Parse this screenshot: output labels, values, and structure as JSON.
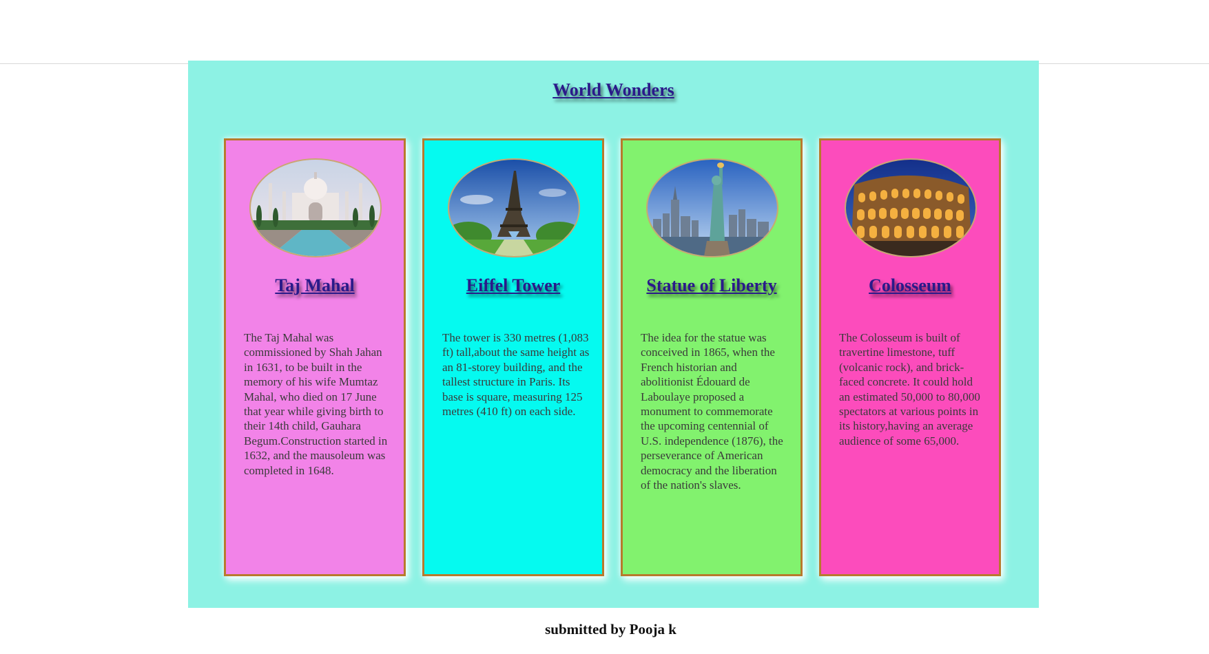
{
  "page": {
    "title": "World Wonders",
    "footer": "submitted by Pooja k"
  },
  "colors": {
    "panel": "#8df2e4",
    "title_link": "#2a1a8a",
    "card_border": "#b87a2c"
  },
  "cards": [
    {
      "title": "Taj Mahal",
      "image": "taj-mahal-photo",
      "background": "#f283e8",
      "description": "The Taj Mahal was commissioned by Shah Jahan in 1631, to be built in the memory of his wife Mumtaz Mahal, who died on 17 June that year while giving birth to their 14th child, Gauhara Begum.Construction started in 1632, and the mausoleum was completed in 1648."
    },
    {
      "title": "Eiffel Tower",
      "image": "eiffel-tower-photo",
      "background": "#05faf0",
      "description": "The tower is 330 metres (1,083 ft) tall,about the same height as an 81-storey building, and the tallest structure in Paris. Its base is square, measuring 125 metres (410 ft) on each side."
    },
    {
      "title": "Statue of Liberty",
      "image": "statue-of-liberty-photo",
      "background": "#82f26e",
      "description": "The idea for the statue was conceived in 1865, when the French historian and abolitionist Édouard de Laboulaye proposed a monument to commemorate the upcoming centennial of U.S. independence (1876), the perseverance of American democracy and the liberation of the nation's slaves."
    },
    {
      "title": "Colosseum",
      "image": "colosseum-photo",
      "background": "#fc4cbc",
      "description": "The Colosseum is built of travertine limestone, tuff (volcanic rock), and brick-faced concrete. It could hold an estimated 50,000 to 80,000 spectators at various points in its history,having an average audience of some 65,000."
    }
  ]
}
